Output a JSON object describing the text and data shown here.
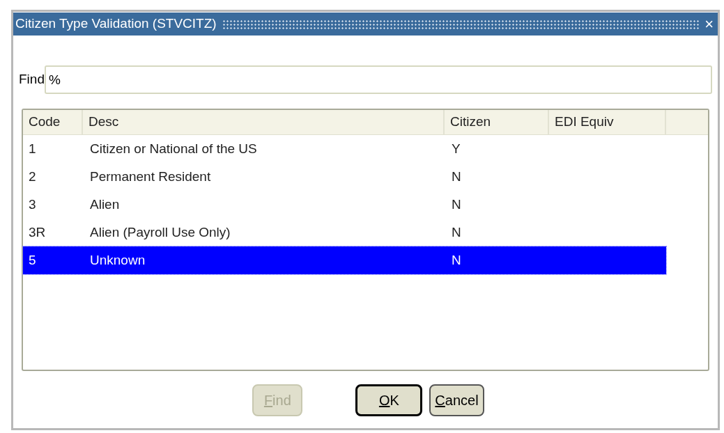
{
  "window": {
    "title": "Citizen Type Validation (STVCITZ)",
    "close": "×"
  },
  "find": {
    "label": "Find",
    "value": "%"
  },
  "table": {
    "columns": [
      "Code",
      "Desc",
      "Citizen",
      "EDI Equiv"
    ],
    "rows": [
      {
        "code": "1",
        "desc": "Citizen or National of the US",
        "citizen": "Y",
        "selected": false
      },
      {
        "code": "2",
        "desc": "Permanent Resident",
        "citizen": "N",
        "selected": false
      },
      {
        "code": "3",
        "desc": "Alien",
        "citizen": "N",
        "selected": false
      },
      {
        "code": "3R",
        "desc": "Alien (Payroll Use Only)",
        "citizen": "N",
        "selected": false
      },
      {
        "code": "5",
        "desc": "Unknown",
        "citizen": "N",
        "selected": true
      }
    ]
  },
  "buttons": [
    {
      "mnemonic": "F",
      "rest": "ind",
      "disabled": true,
      "default": false
    },
    {
      "mnemonic": "O",
      "rest": "K",
      "disabled": false,
      "default": true
    },
    {
      "mnemonic": "C",
      "rest": "ancel",
      "disabled": false,
      "default": false
    }
  ]
}
